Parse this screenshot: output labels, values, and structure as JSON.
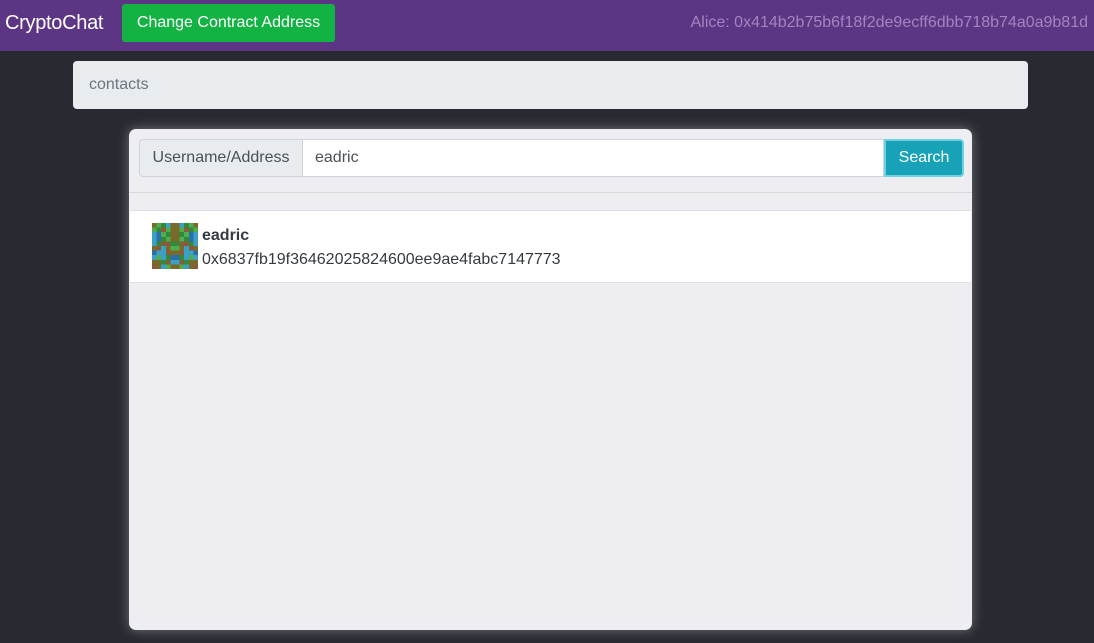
{
  "navbar": {
    "brand": "CryptoChat",
    "change_contract_label": "Change Contract Address",
    "account": "Alice: 0x414b2b75b6f18f2de9ecff6dbb718b74a0a9b81d",
    "background": "#5d3585",
    "button_color": "#12b343"
  },
  "breadcrumb": {
    "current": "contacts"
  },
  "search": {
    "prepend_label": "Username/Address",
    "value": "eadric",
    "button_label": "Search",
    "button_color": "#17a2b8"
  },
  "results": [
    {
      "name": "eadric",
      "address": "0x6837fb19f36462025824600ee9ae4fabc7147773",
      "avatar_icon": "identicon"
    }
  ]
}
